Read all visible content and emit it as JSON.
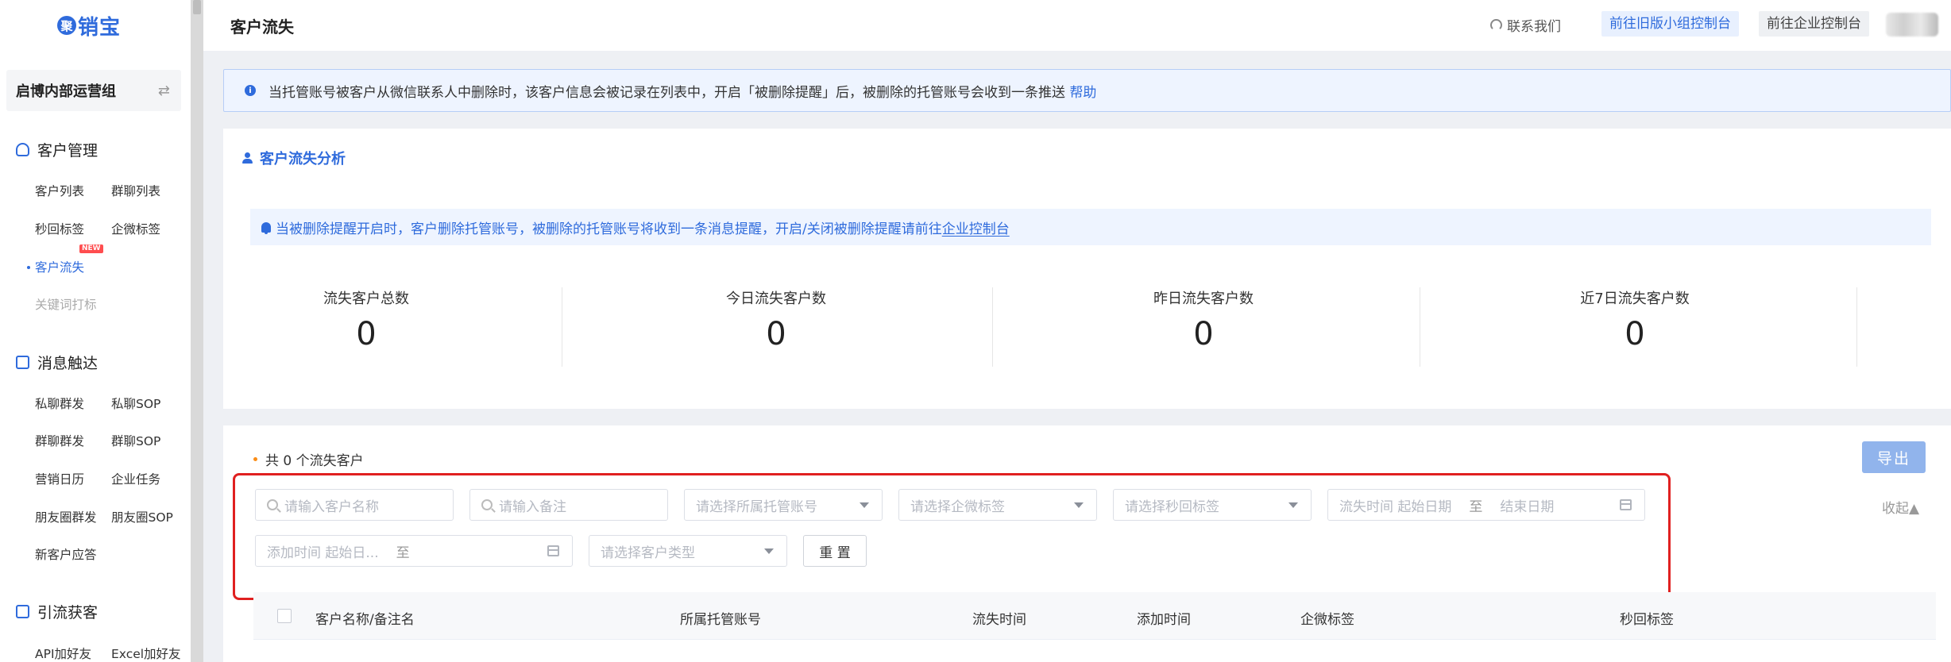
{
  "brand": {
    "logo_char": "聚",
    "logo_text": "销宝"
  },
  "sidebar": {
    "team_name": "启博内部运营组",
    "switch_icon": "⇄",
    "groups": [
      {
        "title": "客户管理",
        "items": [
          "客户列表",
          "群聊列表",
          "秒回标签",
          "企微标签",
          "客户流失",
          "关键词打标"
        ]
      },
      {
        "title": "消息触达",
        "items": [
          "私聊群发",
          "私聊SOP",
          "群聊群发",
          "群聊SOP",
          "营销日历",
          "企业任务",
          "朋友圈群发",
          "朋友圈SOP",
          "新客户应答"
        ]
      },
      {
        "title": "引流获客",
        "items": [
          "API加好友",
          "Excel加好友"
        ]
      }
    ],
    "new_badge": "NEW"
  },
  "topbar": {
    "title": "客户流失",
    "contact": "联系我们",
    "old_console": "前往旧版小组控制台",
    "enterprise_console": "前往企业控制台"
  },
  "notice": {
    "text": "当托管账号被客户从微信联系人中删除时，该客户信息会被记录在列表中，开启「被删除提醒」后，被删除的托管账号会收到一条推送",
    "help": "帮助"
  },
  "analysis": {
    "title": "客户流失分析",
    "remind_text": "当被删除提醒开启时，客户删除托管账号，被删除的托管账号将收到一条消息提醒，开启/关闭被删除提醒请前往",
    "remind_link": "企业控制台",
    "stats": [
      {
        "label": "流失客户总数",
        "value": "0"
      },
      {
        "label": "今日流失客户数",
        "value": "0"
      },
      {
        "label": "昨日流失客户数",
        "value": "0"
      },
      {
        "label": "近7日流失客户数",
        "value": "0"
      }
    ]
  },
  "list": {
    "total": "共 0 个流失客户",
    "export": "导出",
    "collapse": "收起▲",
    "filters": {
      "customer_name": "请输入客户名称",
      "remark": "请输入备注",
      "managed_account": "请选择所属托管账号",
      "wecom_tag": "请选择企微标签",
      "quick_tag": "请选择秒回标签",
      "lost_time_label": "流失时间",
      "start_date": "起始日期",
      "to": "至",
      "end_date": "结束日期",
      "add_time_label": "添加时间",
      "add_start": "起始日...",
      "customer_type": "请选择客户类型",
      "reset": "重 置"
    },
    "columns": [
      "客户名称/备注名",
      "所属托管账号",
      "流失时间",
      "添加时间",
      "企微标签",
      "秒回标签"
    ]
  },
  "colors": {
    "accent": "#2f6bdc",
    "highlight": "#e02020",
    "badge": "#ff4d4f"
  }
}
